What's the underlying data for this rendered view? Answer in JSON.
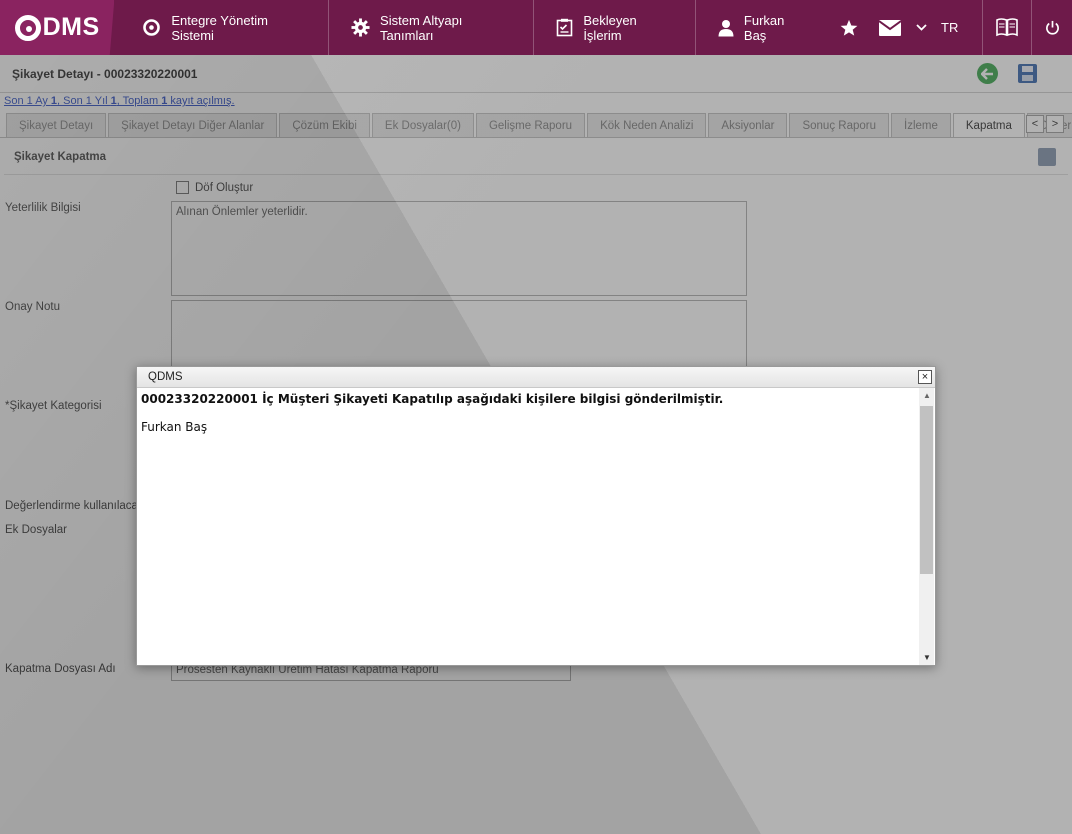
{
  "app": {
    "logo_text": "DMS",
    "nav": [
      {
        "label": "Entegre Yönetim Sistemi"
      },
      {
        "label": "Sistem Altyapı Tanımları"
      },
      {
        "label": "Bekleyen İşlerim"
      },
      {
        "label": "Furkan Baş"
      }
    ],
    "language": "TR"
  },
  "page": {
    "title": "Şikayet Detayı - 00023320220001",
    "records_link": {
      "p1": "Son 1 Ay ",
      "month_count": "1",
      "p2": ", Son 1 Yıl ",
      "year_count": "1",
      "p3": ", Toplam ",
      "total_count": "1",
      "p4": " kayıt açılmış."
    }
  },
  "tabs": [
    {
      "label": "Şikayet Detayı"
    },
    {
      "label": "Şikayet Detayı Diğer Alanlar"
    },
    {
      "label": "Çözüm Ekibi"
    },
    {
      "label": "Ek Dosyalar(0)"
    },
    {
      "label": "Gelişme Raporu"
    },
    {
      "label": "Kök Neden Analizi"
    },
    {
      "label": "Aksiyonlar"
    },
    {
      "label": "Sonuç Raporu"
    },
    {
      "label": "İzleme"
    },
    {
      "label": "Kapatma",
      "active": true
    },
    {
      "label": "Değerler"
    }
  ],
  "tab_nav": {
    "prev": "<",
    "next": ">"
  },
  "form": {
    "section_title": "Şikayet Kapatma",
    "dof_checkbox_label": "Döf Oluştur",
    "yeterlilik_label": "Yeterlilik Bilgisi",
    "yeterlilik_value": "Alınan Önlemler yeterlidir.",
    "onay_label": "Onay Notu",
    "onay_value": "",
    "kategori_label": "*Şikayet Kategorisi",
    "degerlendirme_label": "Değerlendirme kullanılacak",
    "ek_dosyalar_label": "Ek Dosyalar",
    "kapatma_dosya_label": "Kapatma Dosyası Adı",
    "kapatma_dosya_value": "Prosesten Kaynaklı Üretim Hatası Kapatma Raporu"
  },
  "dialog": {
    "title": "QDMS",
    "close_symbol": "×",
    "message": "00023320220001 İç Müşteri Şikayeti Kapatılıp aşağıdaki kişilere bilgisi gönderilmiştir.",
    "recipients": [
      "Furkan Baş"
    ],
    "scroll_up": "▲",
    "scroll_down": "▼"
  }
}
